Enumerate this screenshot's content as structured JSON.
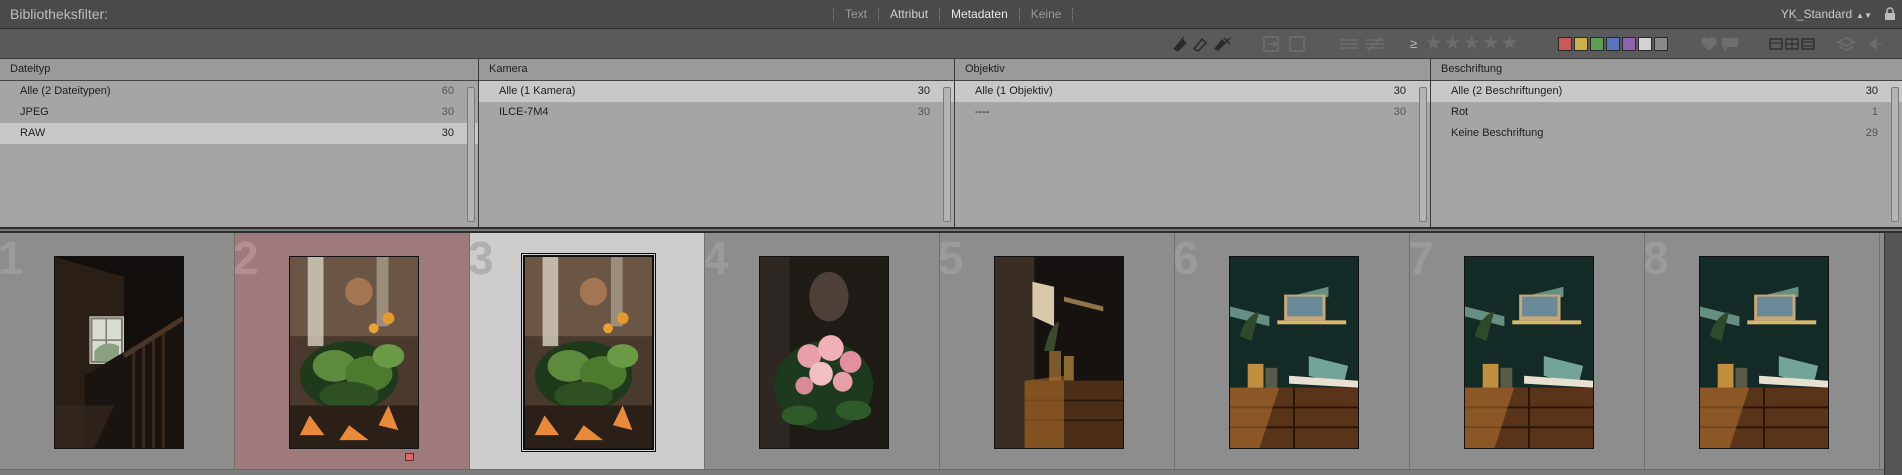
{
  "header": {
    "title": "Bibliotheksfilter:",
    "tabs": [
      {
        "label": "Text",
        "state": "dim"
      },
      {
        "label": "Attribut",
        "state": "normal"
      },
      {
        "label": "Metadaten",
        "state": "active"
      },
      {
        "label": "Keine",
        "state": "dim"
      }
    ],
    "preset": "YK_Standard"
  },
  "toolbar": {
    "rating_operator": "≥",
    "stars": "★★★★★",
    "color_labels": [
      "#c85a5a",
      "#c9b04a",
      "#5f9e57",
      "#5a74b8",
      "#8e63b0",
      "#d2d2d2",
      "#8a8a8a"
    ]
  },
  "columns": [
    {
      "header": "Dateityp",
      "rows": [
        {
          "label": "Alle (2 Dateitypen)",
          "count": "60",
          "selected": false
        },
        {
          "label": "JPEG",
          "count": "30",
          "selected": false
        },
        {
          "label": "RAW",
          "count": "30",
          "selected": true
        }
      ]
    },
    {
      "header": "Kamera",
      "rows": [
        {
          "label": "Alle (1 Kamera)",
          "count": "30",
          "selected": true
        },
        {
          "label": "ILCE-7M4",
          "count": "30",
          "selected": false
        }
      ]
    },
    {
      "header": "Objektiv",
      "rows": [
        {
          "label": "Alle (1 Objektiv)",
          "count": "30",
          "selected": true
        },
        {
          "label": "----",
          "count": "30",
          "selected": false
        }
      ]
    },
    {
      "header": "Beschriftung",
      "rows": [
        {
          "label": "Alle (2 Beschriftungen)",
          "count": "30",
          "selected": true
        },
        {
          "label": "Rot",
          "count": "1",
          "selected": false
        },
        {
          "label": "Keine Beschriftung",
          "count": "29",
          "selected": false
        }
      ]
    }
  ],
  "grid": {
    "cells": [
      {
        "index": "1",
        "scene": "stairs",
        "state": "normal"
      },
      {
        "index": "2",
        "scene": "plant",
        "state": "red"
      },
      {
        "index": "3",
        "scene": "plant",
        "state": "selected"
      },
      {
        "index": "4",
        "scene": "flowers",
        "state": "normal"
      },
      {
        "index": "5",
        "scene": "shelf",
        "state": "normal"
      },
      {
        "index": "6",
        "scene": "room",
        "state": "normal"
      },
      {
        "index": "7",
        "scene": "room",
        "state": "normal"
      },
      {
        "index": "8",
        "scene": "room",
        "state": "normal"
      }
    ]
  }
}
